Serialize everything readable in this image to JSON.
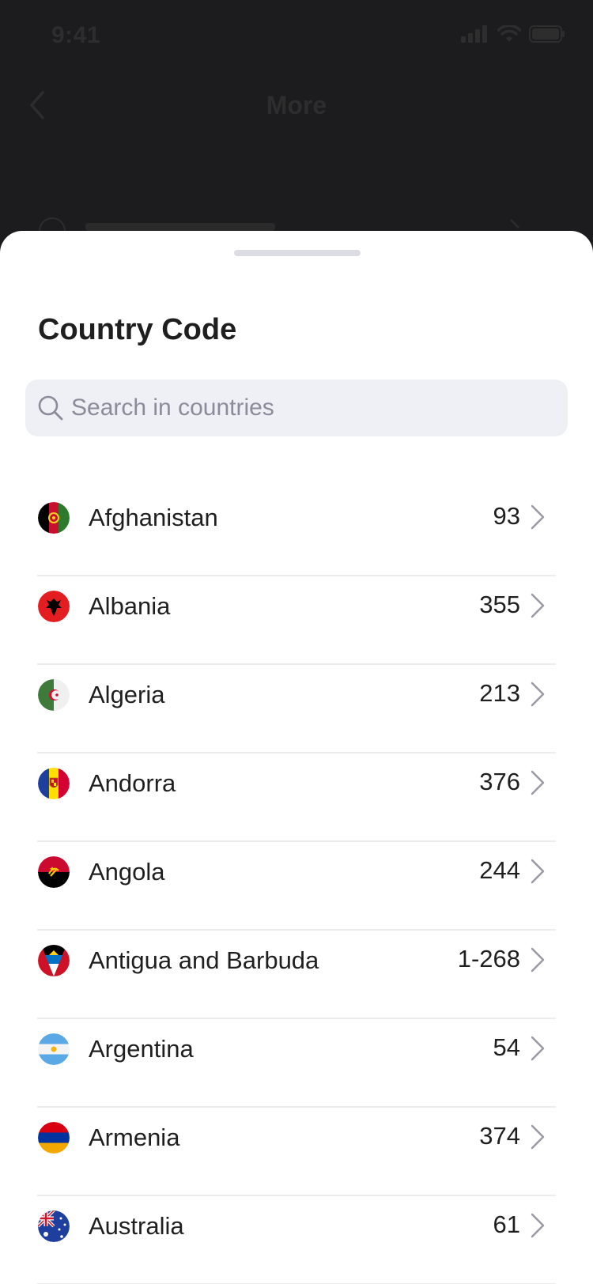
{
  "status": {
    "time": "9:41"
  },
  "nav": {
    "title": "More"
  },
  "sheet": {
    "title": "Country Code",
    "search": {
      "placeholder": "Search in countries",
      "value": ""
    }
  },
  "countries": [
    {
      "name": "Afghanistan",
      "code": "93",
      "flag": "afghanistan-flag-icon"
    },
    {
      "name": "Albania",
      "code": "355",
      "flag": "albania-flag-icon"
    },
    {
      "name": "Algeria",
      "code": "213",
      "flag": "algeria-flag-icon"
    },
    {
      "name": "Andorra",
      "code": "376",
      "flag": "andorra-flag-icon"
    },
    {
      "name": "Angola",
      "code": "244",
      "flag": "angola-flag-icon"
    },
    {
      "name": "Antigua and Barbuda",
      "code": "1-268",
      "flag": "antigua-barbuda-flag-icon"
    },
    {
      "name": "Argentina",
      "code": "54",
      "flag": "argentina-flag-icon"
    },
    {
      "name": "Armenia",
      "code": "374",
      "flag": "armenia-flag-icon"
    },
    {
      "name": "Australia",
      "code": "61",
      "flag": "australia-flag-icon"
    }
  ],
  "colors": {
    "overlay": "#1c1c1e",
    "sheet": "#ffffff",
    "search_bg": "#eef0f5",
    "placeholder": "#8a8d99",
    "divider": "#ececf0",
    "chevron": "#9a9aa5"
  }
}
